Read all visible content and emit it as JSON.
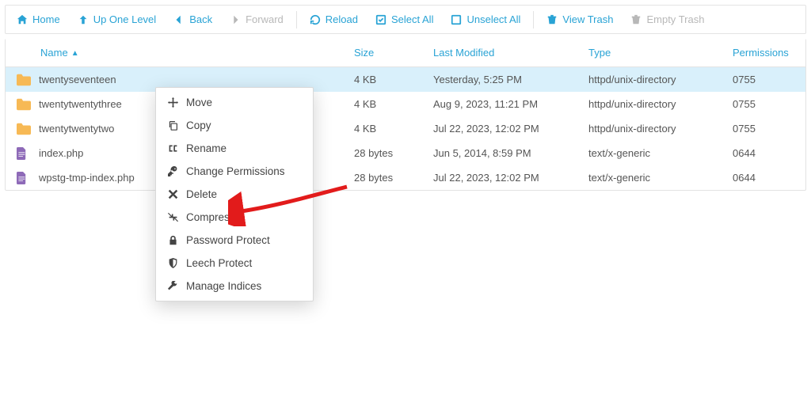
{
  "toolbar": {
    "home": "Home",
    "up": "Up One Level",
    "back": "Back",
    "forward": "Forward",
    "reload": "Reload",
    "select_all": "Select All",
    "unselect_all": "Unselect All",
    "view_trash": "View Trash",
    "empty_trash": "Empty Trash"
  },
  "columns": {
    "name": "Name",
    "size": "Size",
    "modified": "Last Modified",
    "type": "Type",
    "permissions": "Permissions"
  },
  "rows": [
    {
      "icon": "folder",
      "name": "twentyseventeen",
      "size": "4 KB",
      "modified": "Yesterday, 5:25 PM",
      "type": "httpd/unix-directory",
      "perm": "0755",
      "selected": true
    },
    {
      "icon": "folder",
      "name": "twentytwentythree",
      "size": "4 KB",
      "modified": "Aug 9, 2023, 11:21 PM",
      "type": "httpd/unix-directory",
      "perm": "0755",
      "selected": false
    },
    {
      "icon": "folder",
      "name": "twentytwentytwo",
      "size": "4 KB",
      "modified": "Jul 22, 2023, 12:02 PM",
      "type": "httpd/unix-directory",
      "perm": "0755",
      "selected": false
    },
    {
      "icon": "doc",
      "name": "index.php",
      "size": "28 bytes",
      "modified": "Jun 5, 2014, 8:59 PM",
      "type": "text/x-generic",
      "perm": "0644",
      "selected": false
    },
    {
      "icon": "doc",
      "name": "wpstg-tmp-index.php",
      "size": "28 bytes",
      "modified": "Jul 22, 2023, 12:02 PM",
      "type": "text/x-generic",
      "perm": "0644",
      "selected": false
    }
  ],
  "context_menu": [
    {
      "id": "move",
      "label": "Move",
      "icon": "move"
    },
    {
      "id": "copy",
      "label": "Copy",
      "icon": "copy"
    },
    {
      "id": "rename",
      "label": "Rename",
      "icon": "rename"
    },
    {
      "id": "chperm",
      "label": "Change Permissions",
      "icon": "key"
    },
    {
      "id": "delete",
      "label": "Delete",
      "icon": "x"
    },
    {
      "id": "compress",
      "label": "Compress",
      "icon": "compress"
    },
    {
      "id": "pwprotect",
      "label": "Password Protect",
      "icon": "lock"
    },
    {
      "id": "leech",
      "label": "Leech Protect",
      "icon": "shield"
    },
    {
      "id": "indices",
      "label": "Manage Indices",
      "icon": "wrench"
    }
  ],
  "annotation": {
    "arrow_points_to": "compress"
  }
}
